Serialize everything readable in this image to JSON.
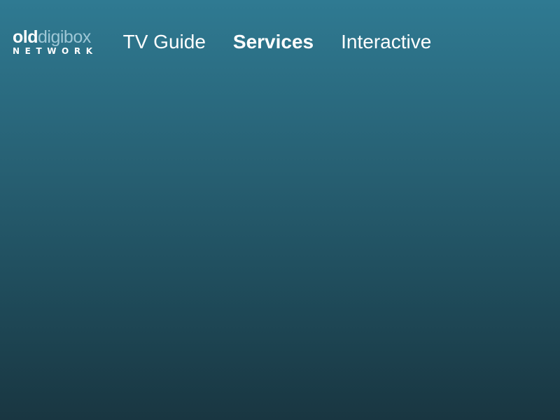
{
  "logo": {
    "old": "old",
    "digibox": "digibox",
    "network": "NETWORK"
  },
  "nav": {
    "items": [
      {
        "label": "TV Guide",
        "active": false
      },
      {
        "label": "Services",
        "active": true
      },
      {
        "label": "Interactive",
        "active": false
      }
    ]
  },
  "colors": {
    "background_top": "#2f7a92",
    "background_bottom": "#193641",
    "text": "#ffffff",
    "logo_light": "#9ec7d6"
  }
}
